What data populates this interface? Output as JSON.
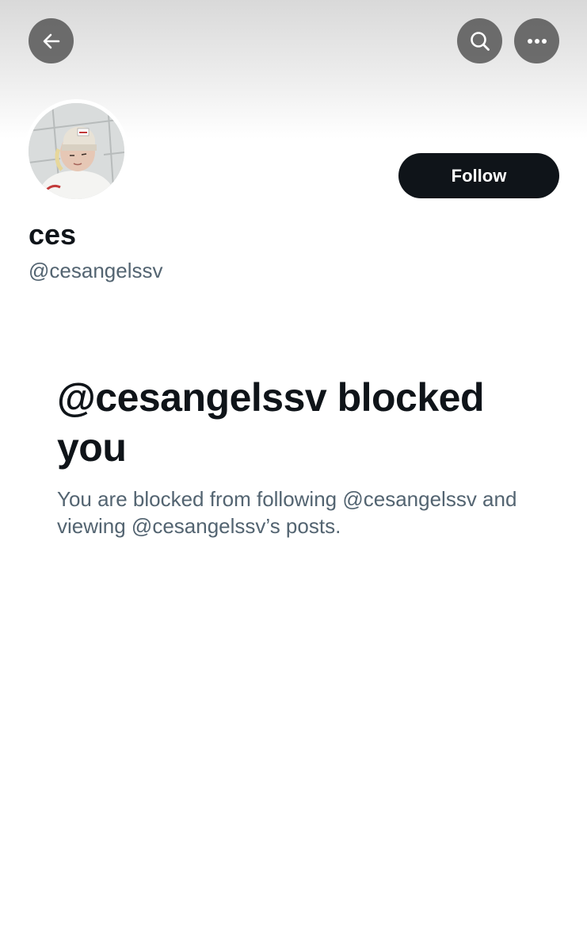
{
  "header": {
    "back_icon": "arrow-left-icon",
    "search_icon": "search-icon",
    "more_icon": "more-horizontal-icon"
  },
  "profile": {
    "display_name": "ces",
    "handle": "@cesangelssv",
    "follow_label": "Follow"
  },
  "blocked": {
    "title": "@cesangelssv blocked you",
    "description": "You are blocked from following @cesangelssv and viewing @cesangelssv’s posts."
  },
  "colors": {
    "primary_text": "#0f1419",
    "secondary_text": "#536471",
    "follow_button_bg": "#0f1419",
    "icon_button_bg": "#5a5a5a"
  }
}
